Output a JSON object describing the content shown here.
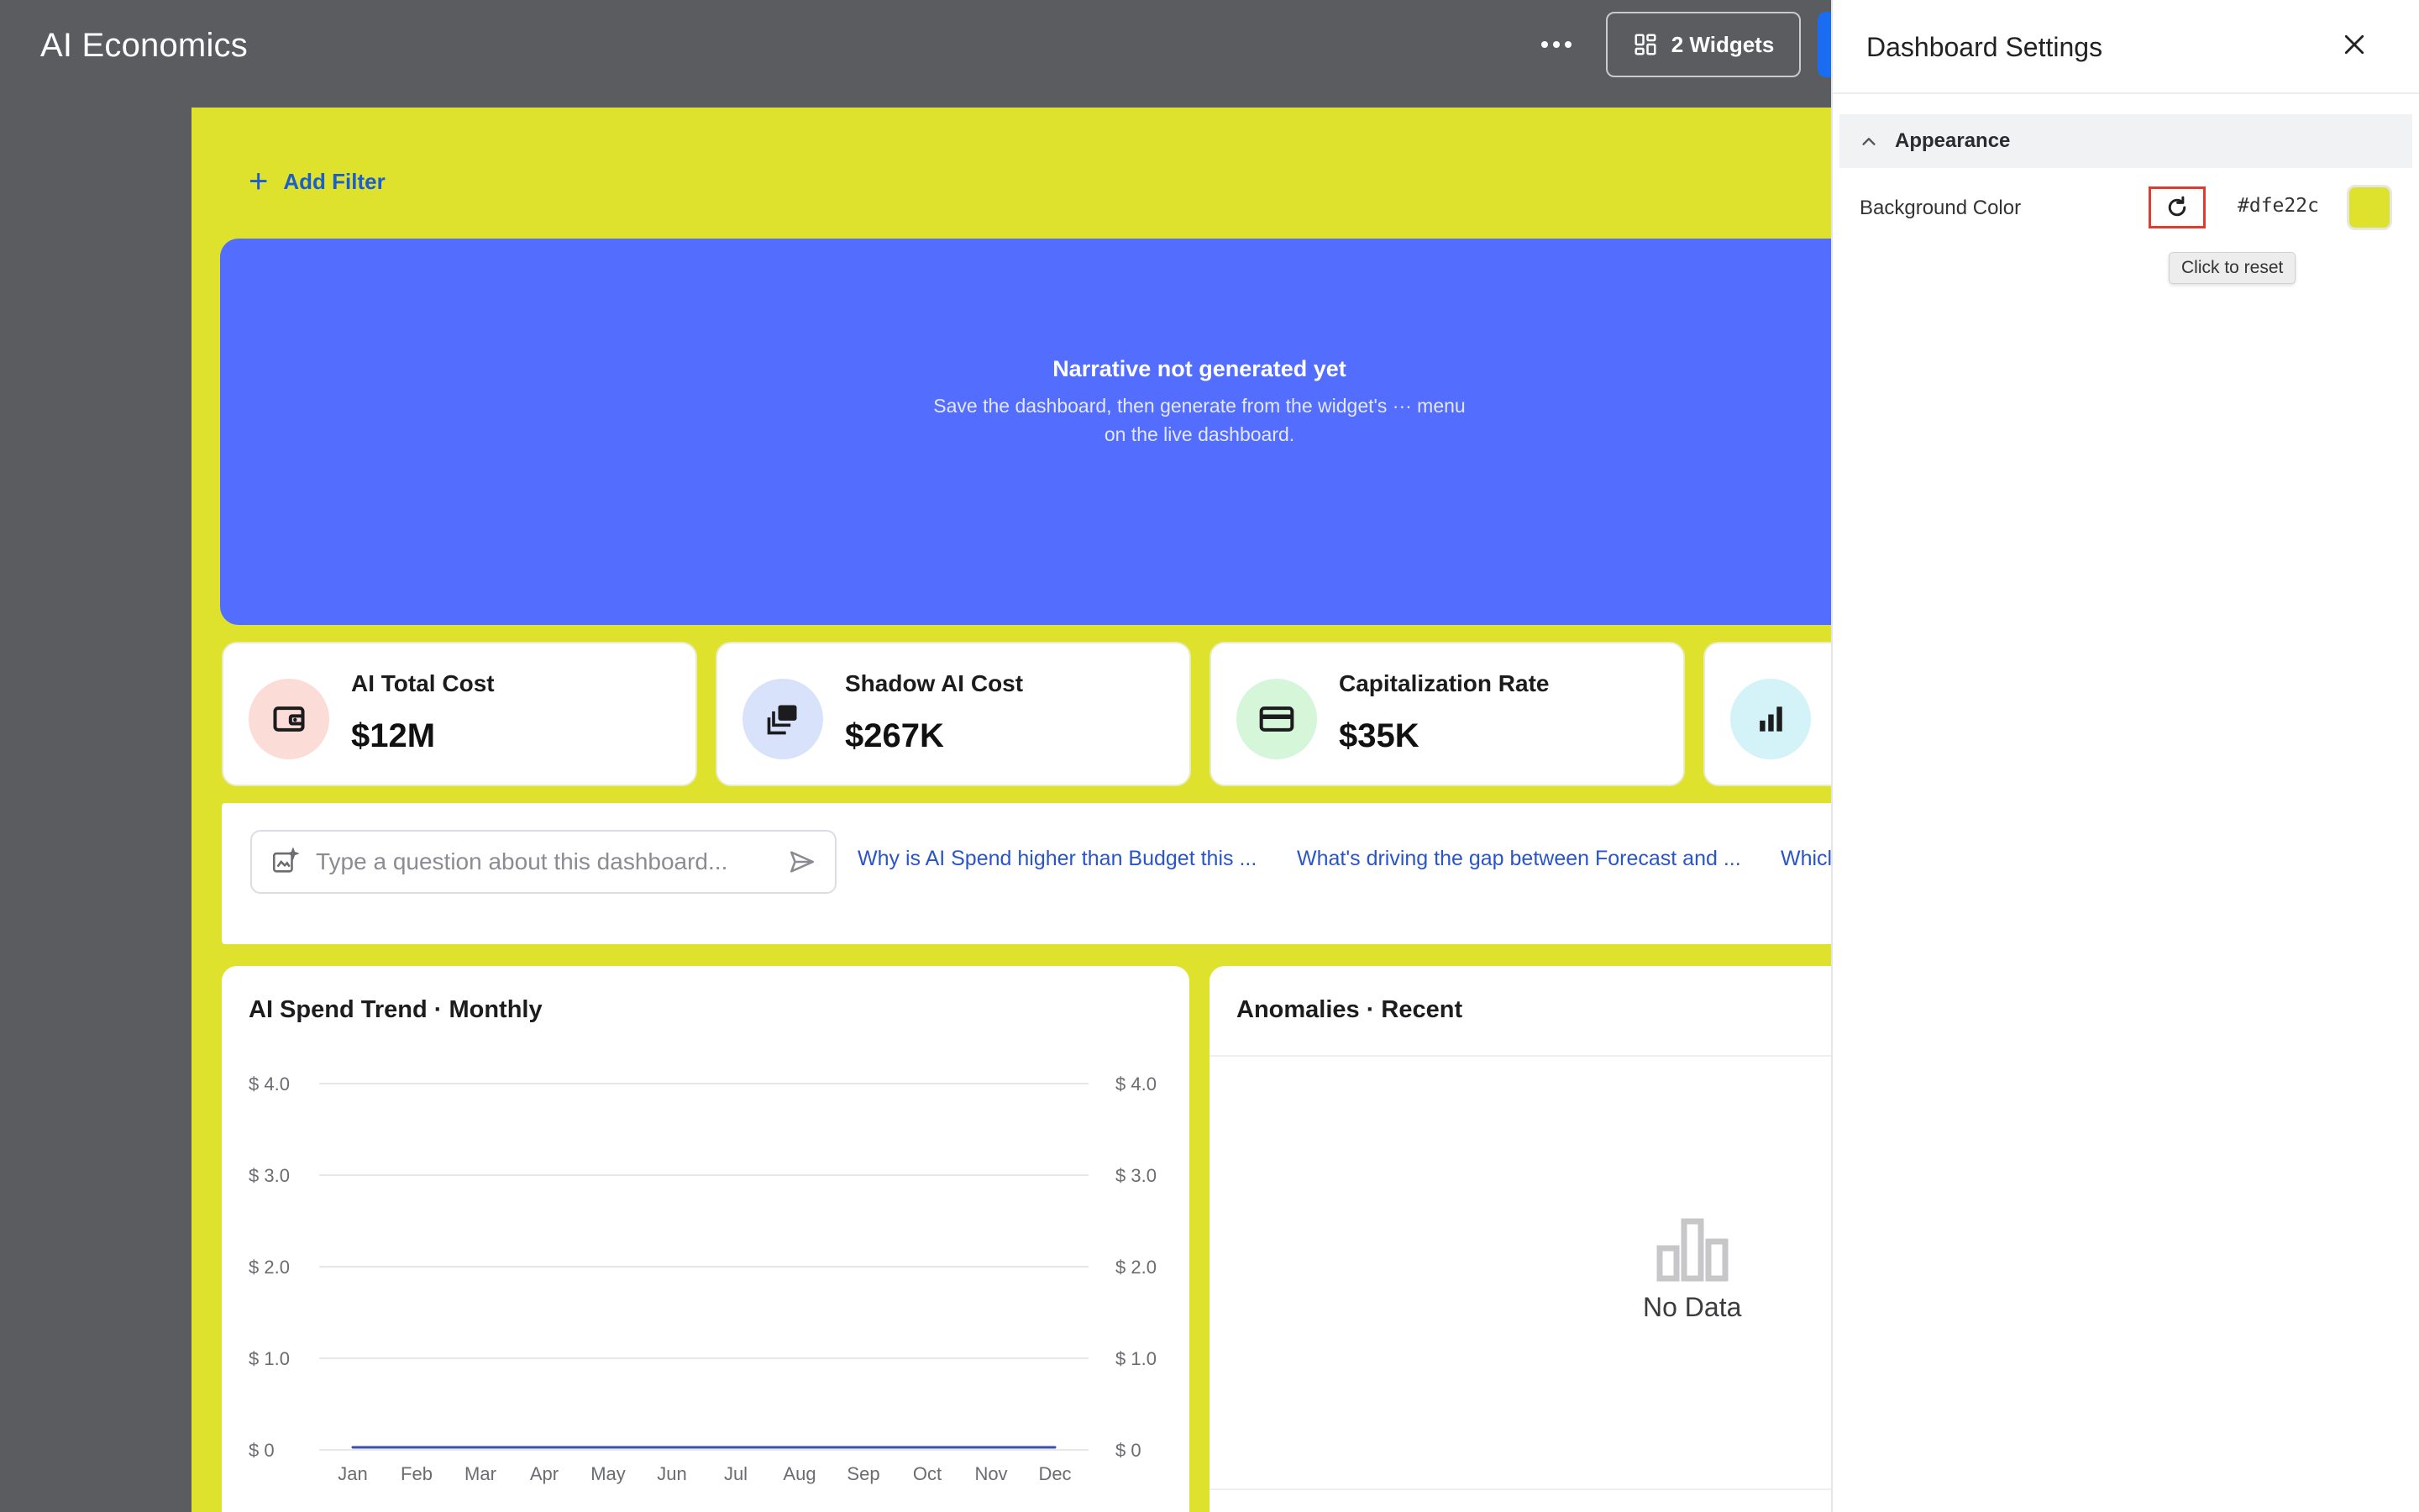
{
  "app": {
    "title": "AI Economics"
  },
  "toolbar": {
    "widgets_label": "2 Widgets"
  },
  "filters": {
    "add_label": "Add Filter"
  },
  "narrative": {
    "title": "Narrative not generated yet",
    "subtitle": "Save the dashboard, then generate from the widget's ··· menu on the live dashboard."
  },
  "kpis": [
    {
      "label": "AI Total Cost",
      "value": "$12M",
      "icon": "wallet-icon",
      "icon_bg": "#fcdcd6"
    },
    {
      "label": "Shadow AI Cost",
      "value": "$267K",
      "icon": "layers-icon",
      "icon_bg": "#d8e3fb"
    },
    {
      "label": "Capitalization Rate",
      "value": "$35K",
      "icon": "credit-card-icon",
      "icon_bg": "#d6f6d9"
    },
    {
      "label": "",
      "value": "",
      "icon": "bar-chart-icon",
      "icon_bg": "#d4f3f8"
    }
  ],
  "ask": {
    "placeholder": "Type a question about this dashboard...",
    "suggestions": [
      "Why is AI Spend higher than Budget this ...",
      "What's driving the gap between Forecast and ...",
      "Whicl"
    ]
  },
  "spend_card": {
    "title": "AI Spend Trend · Monthly"
  },
  "anomalies_card": {
    "title": "Anomalies · Recent",
    "empty_text": "No Data"
  },
  "chart_data": {
    "type": "line",
    "title": "AI Spend Trend · Monthly",
    "categories": [
      "Jan",
      "Feb",
      "Mar",
      "Apr",
      "May",
      "Jun",
      "Jul",
      "Aug",
      "Sep",
      "Oct",
      "Nov",
      "Dec"
    ],
    "series": [
      {
        "values": [
          0,
          0,
          0,
          0,
          0,
          0,
          0,
          0,
          0,
          0,
          0,
          0
        ],
        "color": "#3a4fb0"
      }
    ],
    "y_ticks": [
      "$ 0",
      "$ 1.0",
      "$ 2.0",
      "$ 3.0",
      "$ 4.0"
    ],
    "y2_ticks": [
      "$ 0",
      "$ 1.0",
      "$ 2.0",
      "$ 3.0",
      "$ 4.0"
    ],
    "ylim": [
      0,
      4
    ],
    "grid": true
  },
  "settings": {
    "title": "Dashboard Settings",
    "section": "Appearance",
    "background_label": "Background Color",
    "background_hex": "#dfe22c",
    "reset_tooltip": "Click to reset"
  },
  "colors": {
    "canvas_bg": "#dfe22c",
    "narrative_bg": "#536dfe",
    "link": "#2a55c9",
    "reset_outline": "#e33a2e"
  }
}
